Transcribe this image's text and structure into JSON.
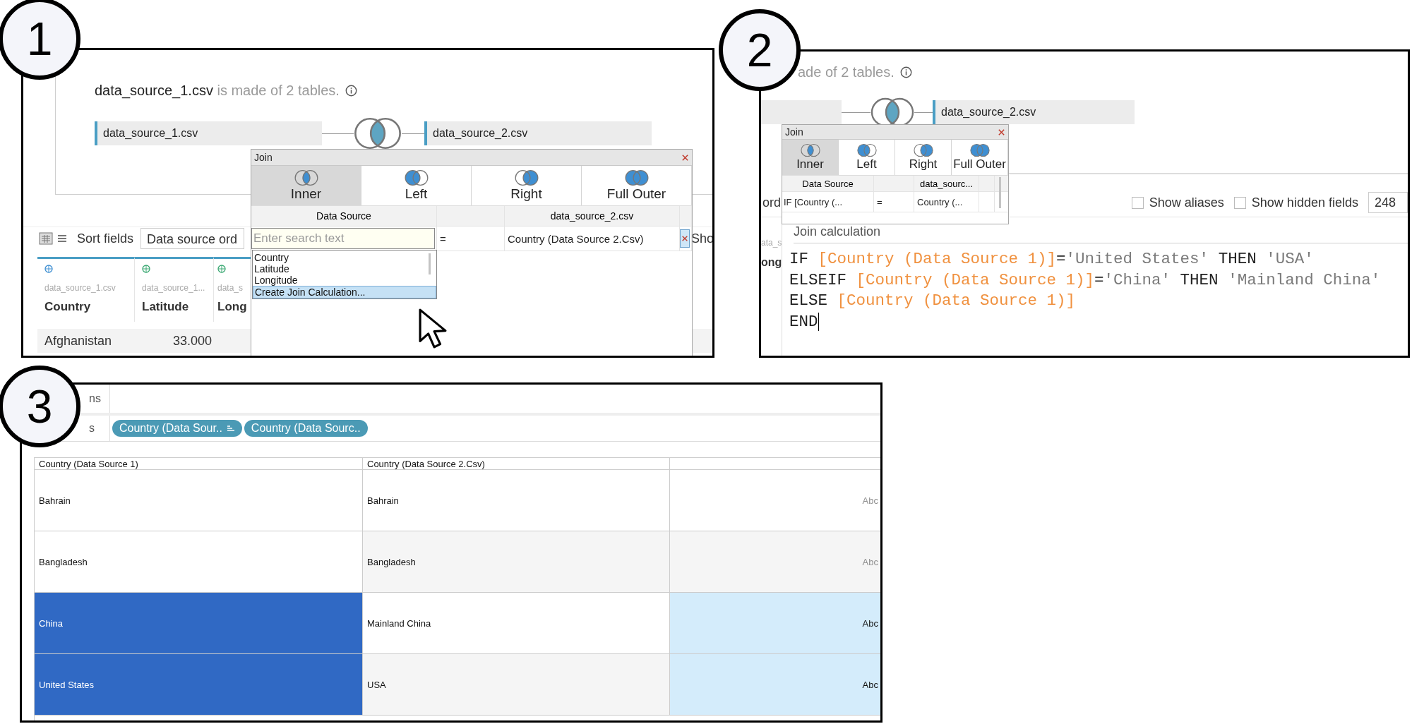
{
  "step_1": {
    "badge": "1",
    "summary": {
      "name": "data_source_1.csv",
      "text": "is made of 2 tables."
    },
    "tables": [
      "data_source_1.csv",
      "data_source_2.csv"
    ],
    "toolbar": {
      "sort_label": "Sort fields",
      "sort_value": "Data source ord",
      "cut_text": "Sho"
    },
    "fields": [
      {
        "source": "data_source_1.csv",
        "name": "Country"
      },
      {
        "source": "data_source_1...",
        "name": "Latitude"
      },
      {
        "source": "data_s",
        "name": "Long"
      }
    ],
    "rows": [
      [
        "Afghanistan",
        "33.000"
      ]
    ],
    "join_dialog": {
      "title": "Join",
      "join_types": [
        {
          "label": "Inner",
          "kind": "inner",
          "selected": true
        },
        {
          "label": "Left",
          "kind": "left",
          "selected": false
        },
        {
          "label": "Right",
          "kind": "right",
          "selected": false
        },
        {
          "label": "Full Outer",
          "kind": "full",
          "selected": false
        }
      ],
      "columns": [
        "Data Source",
        "data_source_2.csv"
      ],
      "clause": {
        "left": {
          "placeholder": "Enter search text"
        },
        "operator": "=",
        "right": "Country (Data Source 2.Csv)"
      },
      "dropdown": [
        {
          "label": "Country",
          "selected": false
        },
        {
          "label": "Latitude",
          "selected": false
        },
        {
          "label": "Longitude",
          "selected": false
        },
        {
          "label": "Create Join Calculation...",
          "selected": true
        }
      ]
    }
  },
  "step_2": {
    "badge": "2",
    "summary": "ade of 2 tables.",
    "tables": [
      "data_source_2.csv"
    ],
    "toolbar": {
      "cut_text": "ord",
      "options": [
        {
          "label": "Show aliases",
          "checked": false
        },
        {
          "label": "Show hidden fields",
          "checked": false
        }
      ],
      "row_count": "248"
    },
    "field_fragments": [
      "ata_s",
      "ong"
    ],
    "join_dialog": {
      "title": "Join",
      "join_types": [
        {
          "label": "Inner",
          "kind": "inner",
          "selected": true
        },
        {
          "label": "Left",
          "kind": "left",
          "selected": false
        },
        {
          "label": "Right",
          "kind": "right",
          "selected": false
        },
        {
          "label": "Full Outer",
          "kind": "full",
          "selected": false
        }
      ],
      "columns": [
        "Data Source",
        "data_sourc..."
      ],
      "clause": {
        "left": "IF [Country (...",
        "operator": "=",
        "right": "Country (..."
      }
    },
    "calculation": {
      "title": "Join calculation",
      "lines": [
        [
          {
            "kind": "keyword",
            "text": "IF "
          },
          {
            "kind": "field",
            "text": "[Country (Data Source 1)]"
          },
          {
            "kind": "keyword",
            "text": "="
          },
          {
            "kind": "string",
            "text": "'United States'"
          },
          {
            "kind": "keyword",
            "text": " THEN "
          },
          {
            "kind": "string",
            "text": "'USA'"
          }
        ],
        [
          {
            "kind": "keyword",
            "text": "ELSEIF "
          },
          {
            "kind": "field",
            "text": "[Country (Data Source 1)]"
          },
          {
            "kind": "keyword",
            "text": "="
          },
          {
            "kind": "string",
            "text": "'China'"
          },
          {
            "kind": "keyword",
            "text": " THEN "
          },
          {
            "kind": "string",
            "text": "'Mainland China'"
          }
        ],
        [
          {
            "kind": "keyword",
            "text": "ELSE "
          },
          {
            "kind": "field",
            "text": "[Country (Data Source 1)]"
          }
        ],
        [
          {
            "kind": "keyword",
            "text": "END"
          }
        ]
      ]
    }
  },
  "step_3": {
    "badge": "3",
    "shelves": [
      {
        "label": "ns"
      },
      {
        "label": "s",
        "pills": [
          {
            "text": "Country (Data Sour..",
            "sorted": true
          },
          {
            "text": "Country (Data Sourc..",
            "sorted": false
          }
        ]
      }
    ],
    "table": {
      "columns": [
        "Country (Data Source 1)",
        "Country (Data Source 2.Csv)"
      ],
      "rows": [
        {
          "cells": [
            "Bahrain",
            "Bahrain"
          ],
          "marker": "Abc",
          "selected": false
        },
        {
          "cells": [
            "Bangladesh",
            "Bangladesh"
          ],
          "marker": "Abc",
          "selected": false
        },
        {
          "cells": [
            "China",
            "Mainland China"
          ],
          "marker": "Abc",
          "selected": true
        },
        {
          "cells": [
            "United States",
            "USA"
          ],
          "marker": "Abc",
          "selected": true
        }
      ]
    }
  }
}
